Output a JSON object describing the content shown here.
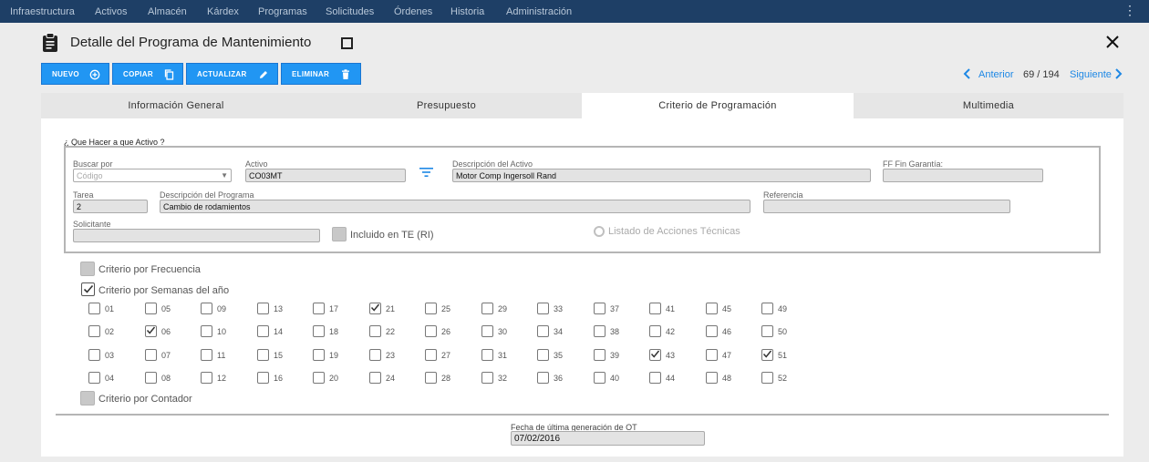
{
  "topnav": {
    "items": [
      "Infraestructura",
      "Activos",
      "Almacén",
      "Kárdex",
      "Programas",
      "Solicitudes",
      "Órdenes",
      "Historia",
      "Administración"
    ],
    "menu_glyph": "⋮"
  },
  "page": {
    "title": "Detalle del Programa de Mantenimiento",
    "title_icon": "clipboard-icon",
    "close_icon": "close-icon"
  },
  "toolbar": {
    "nuevo": "NUEVO",
    "copiar": "COPIAR",
    "actualizar": "ACTUALIZAR",
    "eliminar": "ELIMINAR"
  },
  "pager": {
    "prev": "Anterior",
    "count": "69 / 194",
    "next": "Siguiente"
  },
  "tabs": [
    "Información General",
    "Presupuesto",
    "Criterio de Programación",
    "Multimedia"
  ],
  "active_tab": "Criterio de Programación",
  "form": {
    "section_title": "¿ Que Hacer a que Activo ?",
    "buscar_label": "Buscar por",
    "buscar_placeholder": "Código",
    "buscar_arrow": "▼",
    "activo_label": "Activo",
    "activo_value": "CO03MT",
    "descripcion_activo_label": "Descripción del Activo",
    "descripcion_activo_value": "Motor Comp Ingersoll Rand",
    "ff_label": "FF Fin Garantía:",
    "ff_value": "",
    "tarea_label": "Tarea",
    "tarea_value": "2",
    "descripcion_programa_label": "Descripción del Programa",
    "descripcion_programa_value": "Cambio de rodamientos",
    "referencia_label": "Referencia",
    "referencia_value": "",
    "solicitante_label": "Solicitante",
    "solicitante_value": "",
    "incluido_label": "Incluido en TE (RI)",
    "listado_label": "Listado de Acciones Técnicas"
  },
  "criterios": {
    "frecuencia": "Criterio por Frecuencia",
    "semanas": "Criterio por Semanas del año",
    "semanas_checked": true,
    "contador": "Criterio por Contador"
  },
  "weeks": [
    {
      "n": "01",
      "checked": false
    },
    {
      "n": "02",
      "checked": false
    },
    {
      "n": "03",
      "checked": false
    },
    {
      "n": "04",
      "checked": false
    },
    {
      "n": "05",
      "checked": false
    },
    {
      "n": "06",
      "checked": true
    },
    {
      "n": "07",
      "checked": false
    },
    {
      "n": "08",
      "checked": false
    },
    {
      "n": "09",
      "checked": false
    },
    {
      "n": "10",
      "checked": false
    },
    {
      "n": "11",
      "checked": false
    },
    {
      "n": "12",
      "checked": false
    },
    {
      "n": "13",
      "checked": false
    },
    {
      "n": "14",
      "checked": false
    },
    {
      "n": "15",
      "checked": false
    },
    {
      "n": "16",
      "checked": false
    },
    {
      "n": "17",
      "checked": false
    },
    {
      "n": "18",
      "checked": false
    },
    {
      "n": "19",
      "checked": false
    },
    {
      "n": "20",
      "checked": false
    },
    {
      "n": "21",
      "checked": true
    },
    {
      "n": "22",
      "checked": false
    },
    {
      "n": "23",
      "checked": false
    },
    {
      "n": "24",
      "checked": false
    },
    {
      "n": "25",
      "checked": false
    },
    {
      "n": "26",
      "checked": false
    },
    {
      "n": "27",
      "checked": false
    },
    {
      "n": "28",
      "checked": false
    },
    {
      "n": "29",
      "checked": false
    },
    {
      "n": "30",
      "checked": false
    },
    {
      "n": "31",
      "checked": false
    },
    {
      "n": "32",
      "checked": false
    },
    {
      "n": "33",
      "checked": false
    },
    {
      "n": "34",
      "checked": false
    },
    {
      "n": "35",
      "checked": false
    },
    {
      "n": "36",
      "checked": false
    },
    {
      "n": "37",
      "checked": false
    },
    {
      "n": "38",
      "checked": false
    },
    {
      "n": "39",
      "checked": false
    },
    {
      "n": "40",
      "checked": false
    },
    {
      "n": "41",
      "checked": false
    },
    {
      "n": "42",
      "checked": false
    },
    {
      "n": "43",
      "checked": true
    },
    {
      "n": "44",
      "checked": false
    },
    {
      "n": "45",
      "checked": false
    },
    {
      "n": "46",
      "checked": false
    },
    {
      "n": "47",
      "checked": false
    },
    {
      "n": "48",
      "checked": false
    },
    {
      "n": "49",
      "checked": false
    },
    {
      "n": "50",
      "checked": false
    },
    {
      "n": "51",
      "checked": true
    },
    {
      "n": "52",
      "checked": false
    }
  ],
  "fecha": {
    "label": "Fecha de última generación de OT",
    "value": "07/02/2016"
  },
  "colors": {
    "topnav_bg": "#1e3f66",
    "button_bg": "#2196f3",
    "link": "#1e88e5"
  }
}
